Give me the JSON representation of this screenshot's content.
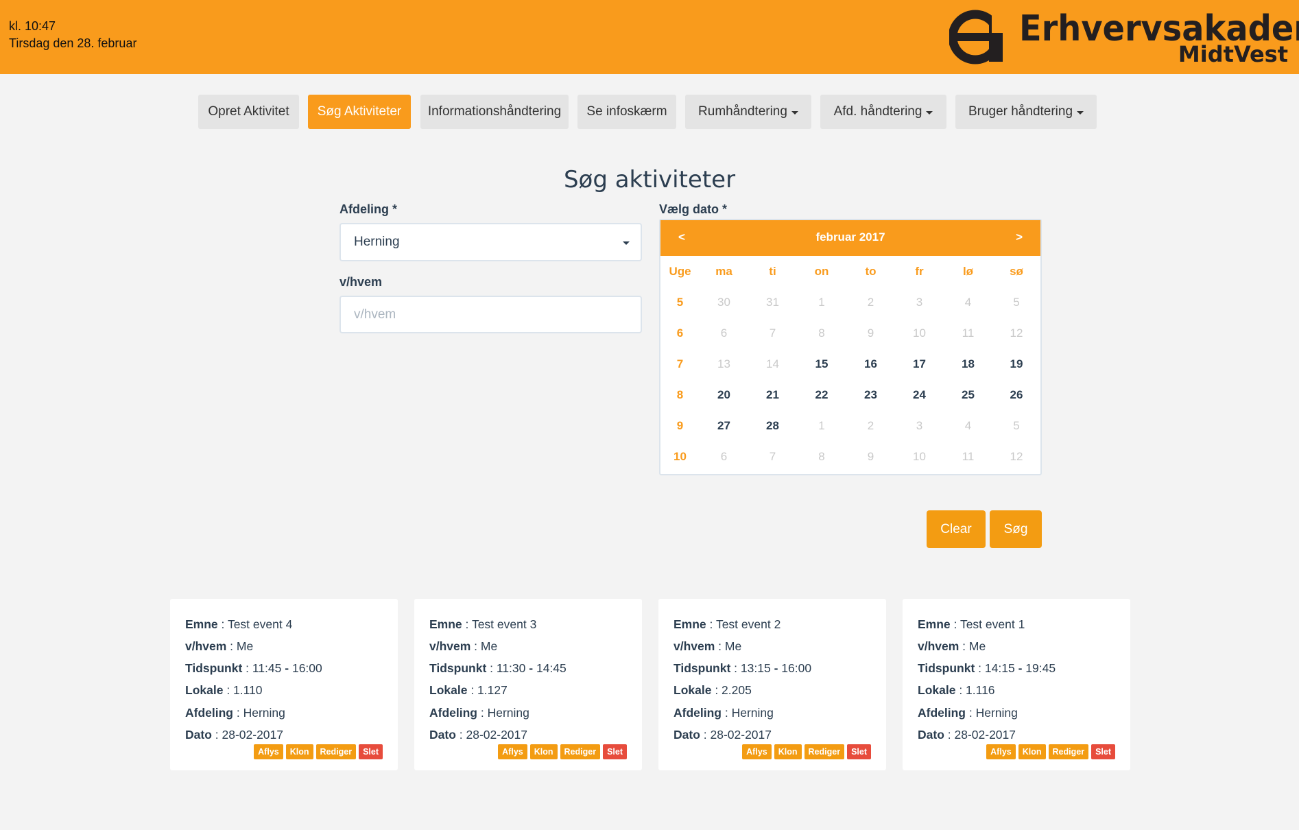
{
  "header": {
    "time": "kl. 10:47",
    "date": "Tirsdag den 28. februar",
    "logo_line1": "Erhvervsakademi",
    "logo_line2": "MidtVest"
  },
  "nav": {
    "items": [
      {
        "label": "Opret Aktivitet"
      },
      {
        "label": "Søg Aktiviteter"
      },
      {
        "label": "Informationshåndtering"
      },
      {
        "label": "Se infoskærm"
      },
      {
        "label": "Rumhåndtering"
      },
      {
        "label": "Afd. håndtering"
      },
      {
        "label": "Bruger håndtering"
      }
    ]
  },
  "search": {
    "title": "Søg aktiviteter",
    "afdeling_label": "Afdeling *",
    "afdeling_value": "Herning",
    "vhvem_label": "v/hvem",
    "vhvem_placeholder": "v/hvem",
    "dato_label": "Vælg dato *"
  },
  "calendar": {
    "prev": "<",
    "next": ">",
    "month": "februar 2017",
    "headers": [
      "Uge",
      "ma",
      "ti",
      "on",
      "to",
      "fr",
      "lø",
      "sø"
    ],
    "weeks": [
      {
        "week": "5",
        "days": [
          [
            "30",
            false
          ],
          [
            "31",
            false
          ],
          [
            "1",
            false
          ],
          [
            "2",
            false
          ],
          [
            "3",
            false
          ],
          [
            "4",
            false
          ],
          [
            "5",
            false
          ]
        ]
      },
      {
        "week": "6",
        "days": [
          [
            "6",
            false
          ],
          [
            "7",
            false
          ],
          [
            "8",
            false
          ],
          [
            "9",
            false
          ],
          [
            "10",
            false
          ],
          [
            "11",
            false
          ],
          [
            "12",
            false
          ]
        ]
      },
      {
        "week": "7",
        "days": [
          [
            "13",
            false
          ],
          [
            "14",
            false
          ],
          [
            "15",
            true
          ],
          [
            "16",
            true
          ],
          [
            "17",
            true
          ],
          [
            "18",
            true
          ],
          [
            "19",
            true
          ]
        ]
      },
      {
        "week": "8",
        "days": [
          [
            "20",
            true
          ],
          [
            "21",
            true
          ],
          [
            "22",
            true
          ],
          [
            "23",
            true
          ],
          [
            "24",
            true
          ],
          [
            "25",
            true
          ],
          [
            "26",
            true
          ]
        ]
      },
      {
        "week": "9",
        "days": [
          [
            "27",
            true
          ],
          [
            "28",
            true
          ],
          [
            "1",
            false
          ],
          [
            "2",
            false
          ],
          [
            "3",
            false
          ],
          [
            "4",
            false
          ],
          [
            "5",
            false
          ]
        ]
      },
      {
        "week": "10",
        "days": [
          [
            "6",
            false
          ],
          [
            "7",
            false
          ],
          [
            "8",
            false
          ],
          [
            "9",
            false
          ],
          [
            "10",
            false
          ],
          [
            "11",
            false
          ],
          [
            "12",
            false
          ]
        ]
      }
    ]
  },
  "buttons": {
    "clear": "Clear",
    "search": "Søg"
  },
  "field_labels": {
    "emne": "Emne",
    "vhvem": "v/hvem",
    "tidspunkt": "Tidspunkt",
    "lokale": "Lokale",
    "afdeling": "Afdeling",
    "dato": "Dato"
  },
  "actions": {
    "aflys": "Aflys",
    "klon": "Klon",
    "rediger": "Rediger",
    "slet": "Slet"
  },
  "events": [
    {
      "emne": "Test event 4",
      "vhvem": "Me",
      "start": "11:45",
      "end": "16:00",
      "lokale": "1.110",
      "afdeling": "Herning",
      "dato": "28-02-2017"
    },
    {
      "emne": "Test event 3",
      "vhvem": "Me",
      "start": "11:30",
      "end": "14:45",
      "lokale": "1.127",
      "afdeling": "Herning",
      "dato": "28-02-2017"
    },
    {
      "emne": "Test event 2",
      "vhvem": "Me",
      "start": "13:15",
      "end": "16:00",
      "lokale": "2.205",
      "afdeling": "Herning",
      "dato": "28-02-2017"
    },
    {
      "emne": "Test event 1",
      "vhvem": "Me",
      "start": "14:15",
      "end": "19:45",
      "lokale": "1.116",
      "afdeling": "Herning",
      "dato": "28-02-2017"
    }
  ],
  "colors": {
    "accent": "#f99b1c",
    "button": "#f39c12",
    "danger": "#e74c3c",
    "text": "#2c3e50",
    "page_bg": "#f3f3f3"
  }
}
